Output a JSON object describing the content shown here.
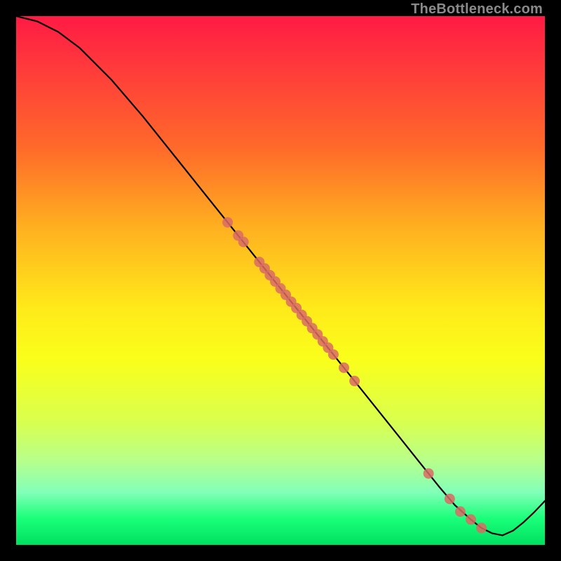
{
  "watermark": "TheBottleneck.com",
  "colors": {
    "marker": "#d96b64",
    "line": "#000000",
    "bg_top": "#ff1a44",
    "bg_bottom": "#00e060"
  },
  "chart_data": {
    "type": "line",
    "title": "",
    "xlabel": "",
    "ylabel": "",
    "xlim": [
      0,
      100
    ],
    "ylim": [
      0,
      100
    ],
    "series": [
      {
        "name": "curve",
        "x": [
          0,
          4,
          8,
          12,
          18,
          24,
          30,
          36,
          42,
          48,
          54,
          60,
          66,
          72,
          76,
          80,
          83,
          86,
          88,
          90,
          92,
          94,
          96,
          98,
          100
        ],
        "y": [
          100,
          99,
          97,
          94,
          88,
          81,
          73.5,
          66,
          58.5,
          51,
          43.5,
          36,
          28.5,
          21,
          16,
          11,
          7.5,
          4.8,
          3.2,
          2.2,
          1.8,
          2.7,
          4.3,
          6.2,
          8.3
        ]
      }
    ],
    "markers": {
      "name": "dots",
      "x": [
        40,
        42,
        43,
        46,
        47,
        48,
        49,
        50,
        51,
        52,
        53,
        54,
        55,
        56,
        57,
        58,
        59,
        60,
        62,
        64,
        78,
        82,
        84,
        86,
        88
      ],
      "y": [
        61,
        58.5,
        57.3,
        53.5,
        52.3,
        51,
        49.8,
        48.5,
        47.3,
        46,
        44.8,
        43.5,
        42.3,
        41,
        39.8,
        38.5,
        37.3,
        36,
        33.5,
        31,
        13.5,
        8.7,
        6.3,
        4.8,
        3.2
      ]
    }
  }
}
